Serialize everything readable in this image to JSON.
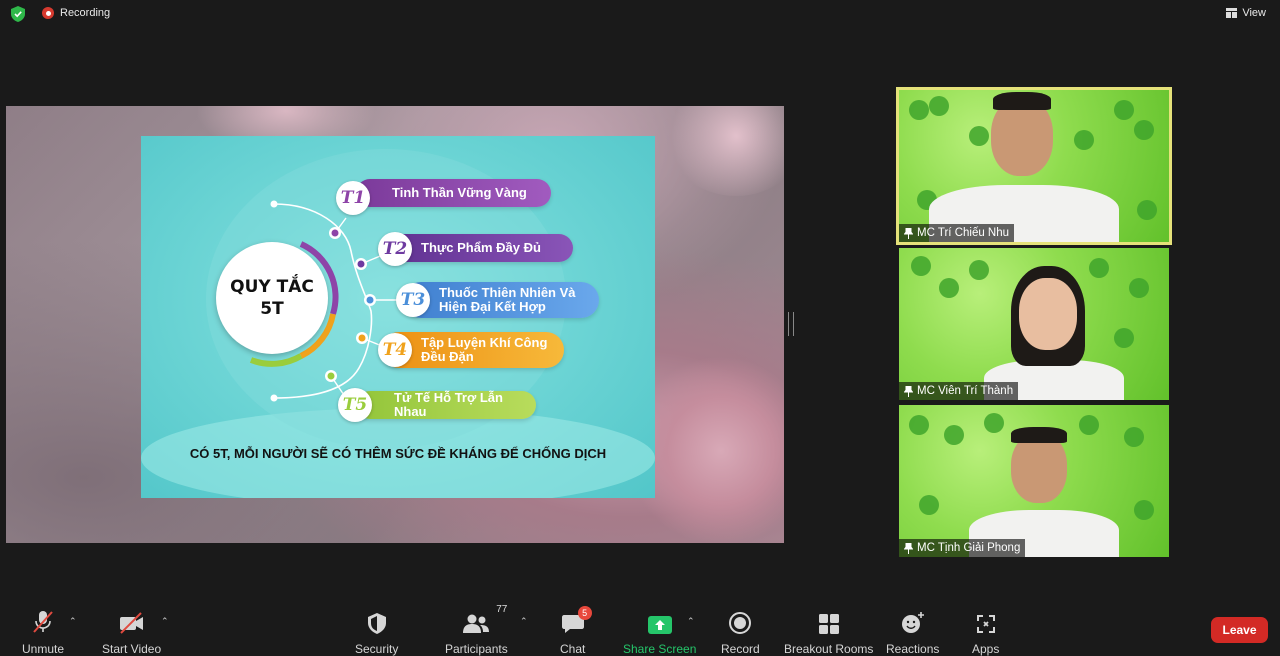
{
  "topbar": {
    "recording_label": "Recording",
    "view_label": "View"
  },
  "slide": {
    "center_title_line1": "QUY TẮC",
    "center_title_line2": "5T",
    "items": [
      {
        "tag": "T1",
        "label": "Tinh Thần Vững Vàng",
        "color": "#8e44a8"
      },
      {
        "tag": "T2",
        "label": "Thực Phẩm Đầy Đủ",
        "color": "#6e3aa0"
      },
      {
        "tag": "T3",
        "label_line1": "Thuốc Thiên Nhiên Và",
        "label_line2": "Hiện Đại Kết Hợp",
        "color": "#4b8fd9"
      },
      {
        "tag": "T4",
        "label_line1": "Tập Luyện Khí Công",
        "label_line2": "Đều Đặn",
        "color": "#f0a21c"
      },
      {
        "tag": "T5",
        "label": "Tử Tế Hỗ Trợ Lẫn Nhau",
        "color": "#9acd3c"
      }
    ],
    "caption": "CÓ 5T, MỖI NGƯỜI SẼ CÓ THÊM SỨC ĐỀ KHÁNG ĐỂ CHỐNG DỊCH"
  },
  "participants": [
    {
      "name": "MC Trí Chiếu Nhu",
      "active": true
    },
    {
      "name": "MC Viên Trí Thành",
      "active": false
    },
    {
      "name": "MC Tịnh Giải Phong",
      "active": false
    }
  ],
  "toolbar": {
    "unmute": "Unmute",
    "start_video": "Start Video",
    "security": "Security",
    "participants": "Participants",
    "participants_count": "77",
    "chat": "Chat",
    "chat_badge": "5",
    "share_screen": "Share Screen",
    "record": "Record",
    "breakout_rooms": "Breakout Rooms",
    "reactions": "Reactions",
    "apps": "Apps",
    "leave": "Leave"
  },
  "colors": {
    "share_screen_green": "#25c56a",
    "leave_red": "#d32a25",
    "active_speaker_border": "#e5e27a"
  }
}
